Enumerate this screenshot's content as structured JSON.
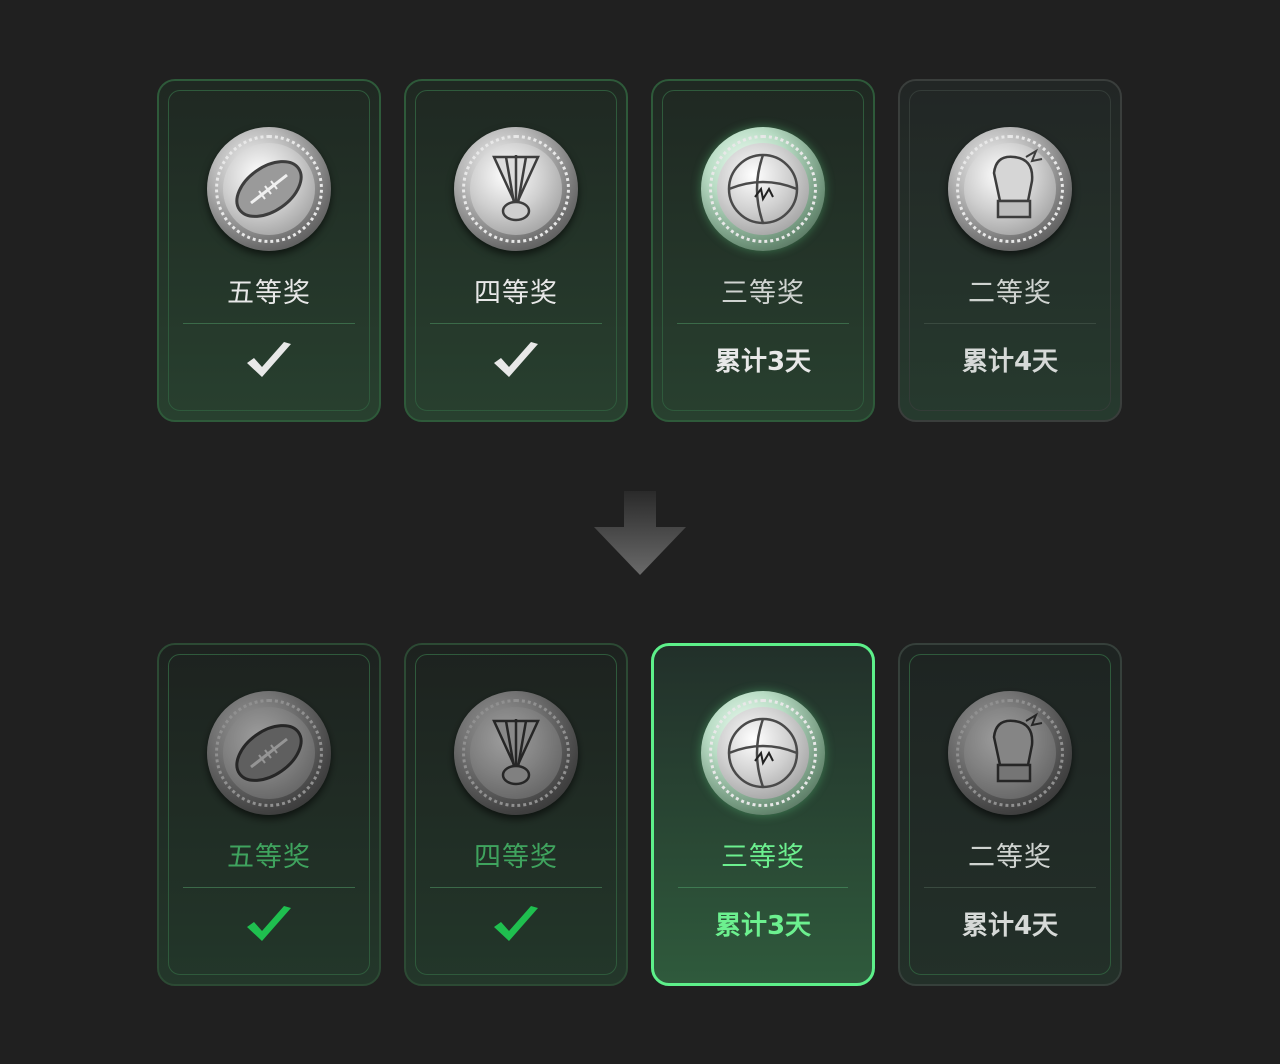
{
  "top_row": [
    {
      "prize": "五等奖",
      "icon": "football-coin-icon",
      "status": "check"
    },
    {
      "prize": "四等奖",
      "icon": "badminton-coin-icon",
      "status": "check"
    },
    {
      "prize": "三等奖",
      "icon": "basketball-coin-icon",
      "status": "累计3天"
    },
    {
      "prize": "二等奖",
      "icon": "boxing-glove-coin-icon",
      "status": "累计4天"
    }
  ],
  "bottom_row": [
    {
      "prize": "五等奖",
      "icon": "football-coin-icon",
      "status": "check"
    },
    {
      "prize": "四等奖",
      "icon": "badminton-coin-icon",
      "status": "check"
    },
    {
      "prize": "三等奖",
      "icon": "basketball-coin-icon",
      "status": "累计3天"
    },
    {
      "prize": "二等奖",
      "icon": "boxing-glove-coin-icon",
      "status": "累计4天"
    }
  ],
  "colors": {
    "background": "#202020",
    "accent_green": "#5df08a",
    "check_green": "#1fbf4f",
    "check_white": "#e8e8e8"
  }
}
